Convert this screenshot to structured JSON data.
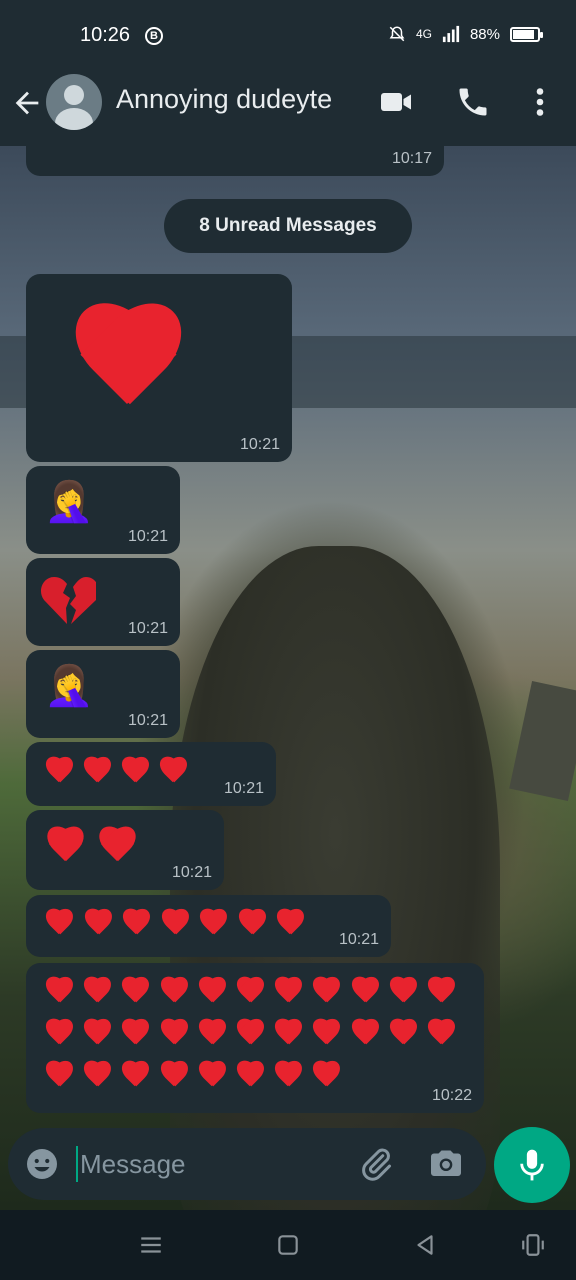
{
  "status_bar": {
    "time": "10:26",
    "b_icon": "B",
    "network": "4G",
    "battery": "88%",
    "battery_level": 0.88
  },
  "header": {
    "contact_name": "Annoying dudeyte"
  },
  "unread_banner": "8 Unread Messages",
  "messages": [
    {
      "time": "10:17"
    },
    {
      "content": "❤️",
      "time": "10:21"
    },
    {
      "content": "🤦‍♀️",
      "time": "10:21"
    },
    {
      "content": "💔",
      "time": "10:21"
    },
    {
      "content": "🤦‍♀️",
      "time": "10:21"
    },
    {
      "content": "❤️❤️❤️❤️",
      "time": "10:21"
    },
    {
      "content": "❤️❤️",
      "time": "10:21"
    },
    {
      "content": "❤️❤️❤️❤️❤️❤️❤️",
      "time": "10:21"
    },
    {
      "content": "❤️❤️❤️❤️❤️❤️❤️❤️❤️❤️❤️❤️❤️❤️❤️❤️❤️❤️❤️❤️❤️❤️❤️❤️❤️❤️❤️❤️❤️❤️",
      "time": "10:22"
    }
  ],
  "composer": {
    "placeholder": "Message"
  },
  "colors": {
    "bubble": "#1f2c33",
    "accent": "#00a884",
    "heart": "#e8232e"
  }
}
